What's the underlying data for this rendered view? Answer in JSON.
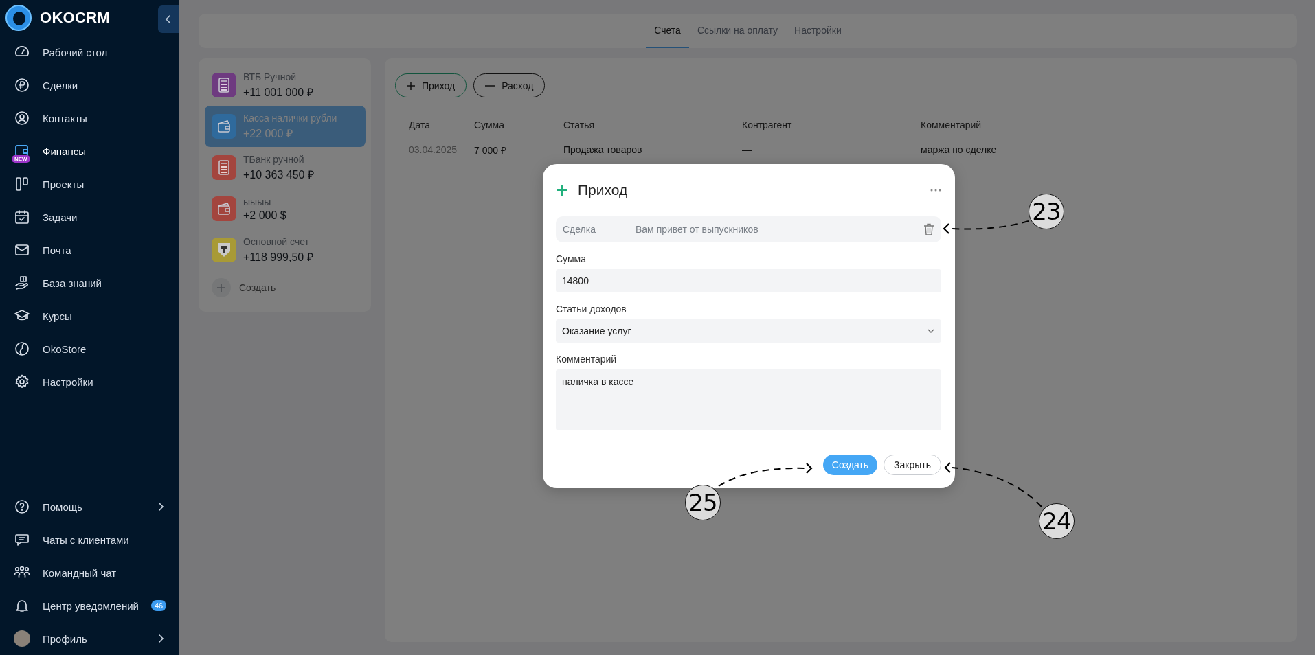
{
  "sidebar": {
    "logo": "OKOCRM",
    "items": [
      {
        "label": "Рабочий стол",
        "kind": "dashboard",
        "selected": false
      },
      {
        "label": "Сделки",
        "kind": "deals",
        "selected": false
      },
      {
        "label": "Контакты",
        "kind": "contacts",
        "selected": false
      },
      {
        "label": "Финансы",
        "kind": "finance",
        "selected": true,
        "badge": "NEW"
      },
      {
        "label": "Проекты",
        "kind": "projects",
        "selected": false
      },
      {
        "label": "Задачи",
        "kind": "tasks",
        "selected": false
      },
      {
        "label": "Почта",
        "kind": "mail",
        "selected": false
      },
      {
        "label": "База знаний",
        "kind": "knowledge",
        "selected": false
      },
      {
        "label": "Курсы",
        "kind": "courses",
        "selected": false
      },
      {
        "label": "OkoStore",
        "kind": "store",
        "selected": false
      },
      {
        "label": "Настройки",
        "kind": "settings",
        "selected": false
      }
    ],
    "bottom_items": [
      {
        "label": "Помощь",
        "kind": "help",
        "chevron": true
      },
      {
        "label": "Чаты с клиентами",
        "kind": "chat",
        "chevron": false
      },
      {
        "label": "Командный чат",
        "kind": "team",
        "chevron": false
      },
      {
        "label": "Центр уведомлений",
        "kind": "bell",
        "chevron": false,
        "badge": "46"
      },
      {
        "label": "Профиль",
        "kind": "avatar",
        "chevron": true
      }
    ]
  },
  "tabs": [
    {
      "label": "Счета",
      "selected": true
    },
    {
      "label": "Ссылки на оплату",
      "selected": false
    },
    {
      "label": "Настройки",
      "selected": false
    }
  ],
  "accounts": {
    "items": [
      {
        "name": "ВТБ Ручной",
        "balance": "+11 001 000 ₽",
        "kind": "calculator",
        "color": "#6e3a80",
        "selected": false
      },
      {
        "name": "Касса налички рубли",
        "balance": "+22 000 ₽",
        "kind": "wallet",
        "color": "#2f6a9c",
        "selected": true
      },
      {
        "name": "ТБанк ручной",
        "balance": "+10 363 450 ₽",
        "kind": "calculator",
        "color": "#a3453e",
        "selected": false
      },
      {
        "name": "ыыыы",
        "balance": "+2 000 $",
        "kind": "wallet",
        "color": "#a3453e",
        "selected": false
      },
      {
        "name": "Основной счет",
        "balance": "+118 999,50 ₽",
        "kind": "bank",
        "color": "#a89a36",
        "selected": false
      }
    ],
    "create_label": "Создать"
  },
  "transactions": {
    "buttons": [
      {
        "label": "Приход",
        "kind": "income"
      },
      {
        "label": "Расход",
        "kind": "expense"
      }
    ],
    "columns": [
      "Дата",
      "Сумма",
      "Статья",
      "Контрагент",
      "Комментарий"
    ],
    "rows": [
      [
        "03.04.2025",
        "7 000 ₽",
        "Продажа товаров",
        "—",
        "маржа по сделке"
      ]
    ]
  },
  "modal": {
    "title": "Приход",
    "fields": [
      {
        "kind": "linked",
        "label": "Сделка",
        "value": "Вам привет от выпускников"
      },
      {
        "kind": "text",
        "label": "Сумма",
        "value": "14800"
      },
      {
        "kind": "select",
        "label": "Статьи доходов",
        "value": "Оказание услуг"
      },
      {
        "kind": "textarea",
        "label": "Комментарий",
        "value": "наличка в кассе"
      }
    ],
    "buttons": [
      {
        "label": "Создать",
        "kind": "primary"
      },
      {
        "label": "Закрыть",
        "kind": "secondary"
      }
    ]
  },
  "callouts": [
    {
      "number": "23"
    },
    {
      "number": "24"
    },
    {
      "number": "25"
    }
  ]
}
